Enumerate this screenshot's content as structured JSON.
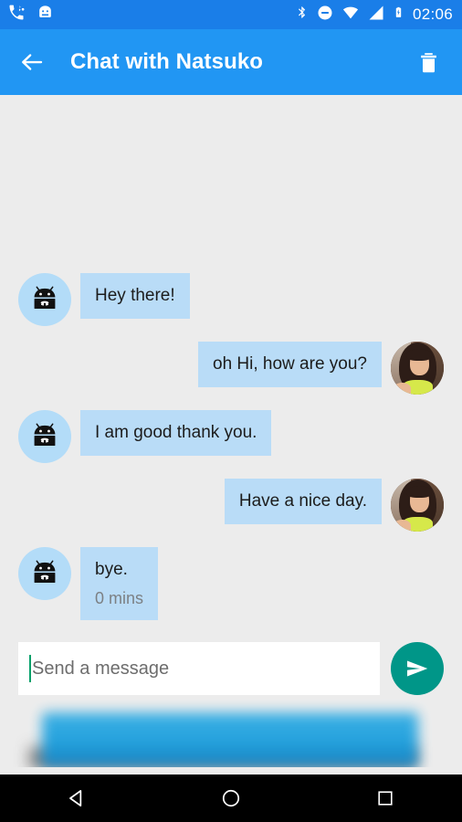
{
  "statusbar": {
    "time": "02:06",
    "left_icons": [
      {
        "name": "call-bluetooth-wifi-icon",
        "glyph": "call"
      },
      {
        "name": "android-head-icon",
        "glyph": "android"
      }
    ],
    "right_icons": [
      {
        "name": "bluetooth-icon"
      },
      {
        "name": "do-not-disturb-icon"
      },
      {
        "name": "wifi-icon"
      },
      {
        "name": "cell-signal-icon"
      },
      {
        "name": "battery-charging-icon"
      }
    ],
    "background_color": "#1a7ee8"
  },
  "appbar": {
    "title": "Chat with Natsuko",
    "back_label": "Back",
    "delete_label": "Delete conversation",
    "background_color": "#2196f3",
    "text_color": "#ffffff"
  },
  "chat": {
    "background_color": "#ececec",
    "bubble_color": "#b9dcf7",
    "bubble_text_color": "#1c1c1c",
    "timestamp_color": "#7c8084",
    "messages": [
      {
        "sender": "bot",
        "avatar": "android-bot-avatar",
        "text": "Hey there!",
        "time": ""
      },
      {
        "sender": "user",
        "avatar": "user-photo-avatar",
        "text": "oh Hi, how are you?",
        "time": ""
      },
      {
        "sender": "bot",
        "avatar": "android-bot-avatar",
        "text": "I am good thank you.",
        "time": ""
      },
      {
        "sender": "user",
        "avatar": "user-photo-avatar",
        "text": "Have a nice day.",
        "time": ""
      },
      {
        "sender": "bot",
        "avatar": "android-bot-avatar",
        "text": "bye.",
        "time": "0 mins"
      }
    ]
  },
  "composer": {
    "placeholder": "Send a message",
    "value": "",
    "send_label": "Send",
    "send_button_color": "#009688",
    "caret_color": "#00a06a"
  },
  "banner": {
    "label": "",
    "color": "#1d9fdd"
  },
  "navbar": {
    "background_color": "#000000",
    "buttons": [
      {
        "name": "back-nav-button",
        "label": "Back"
      },
      {
        "name": "home-nav-button",
        "label": "Home"
      },
      {
        "name": "recents-nav-button",
        "label": "Recents"
      }
    ]
  }
}
